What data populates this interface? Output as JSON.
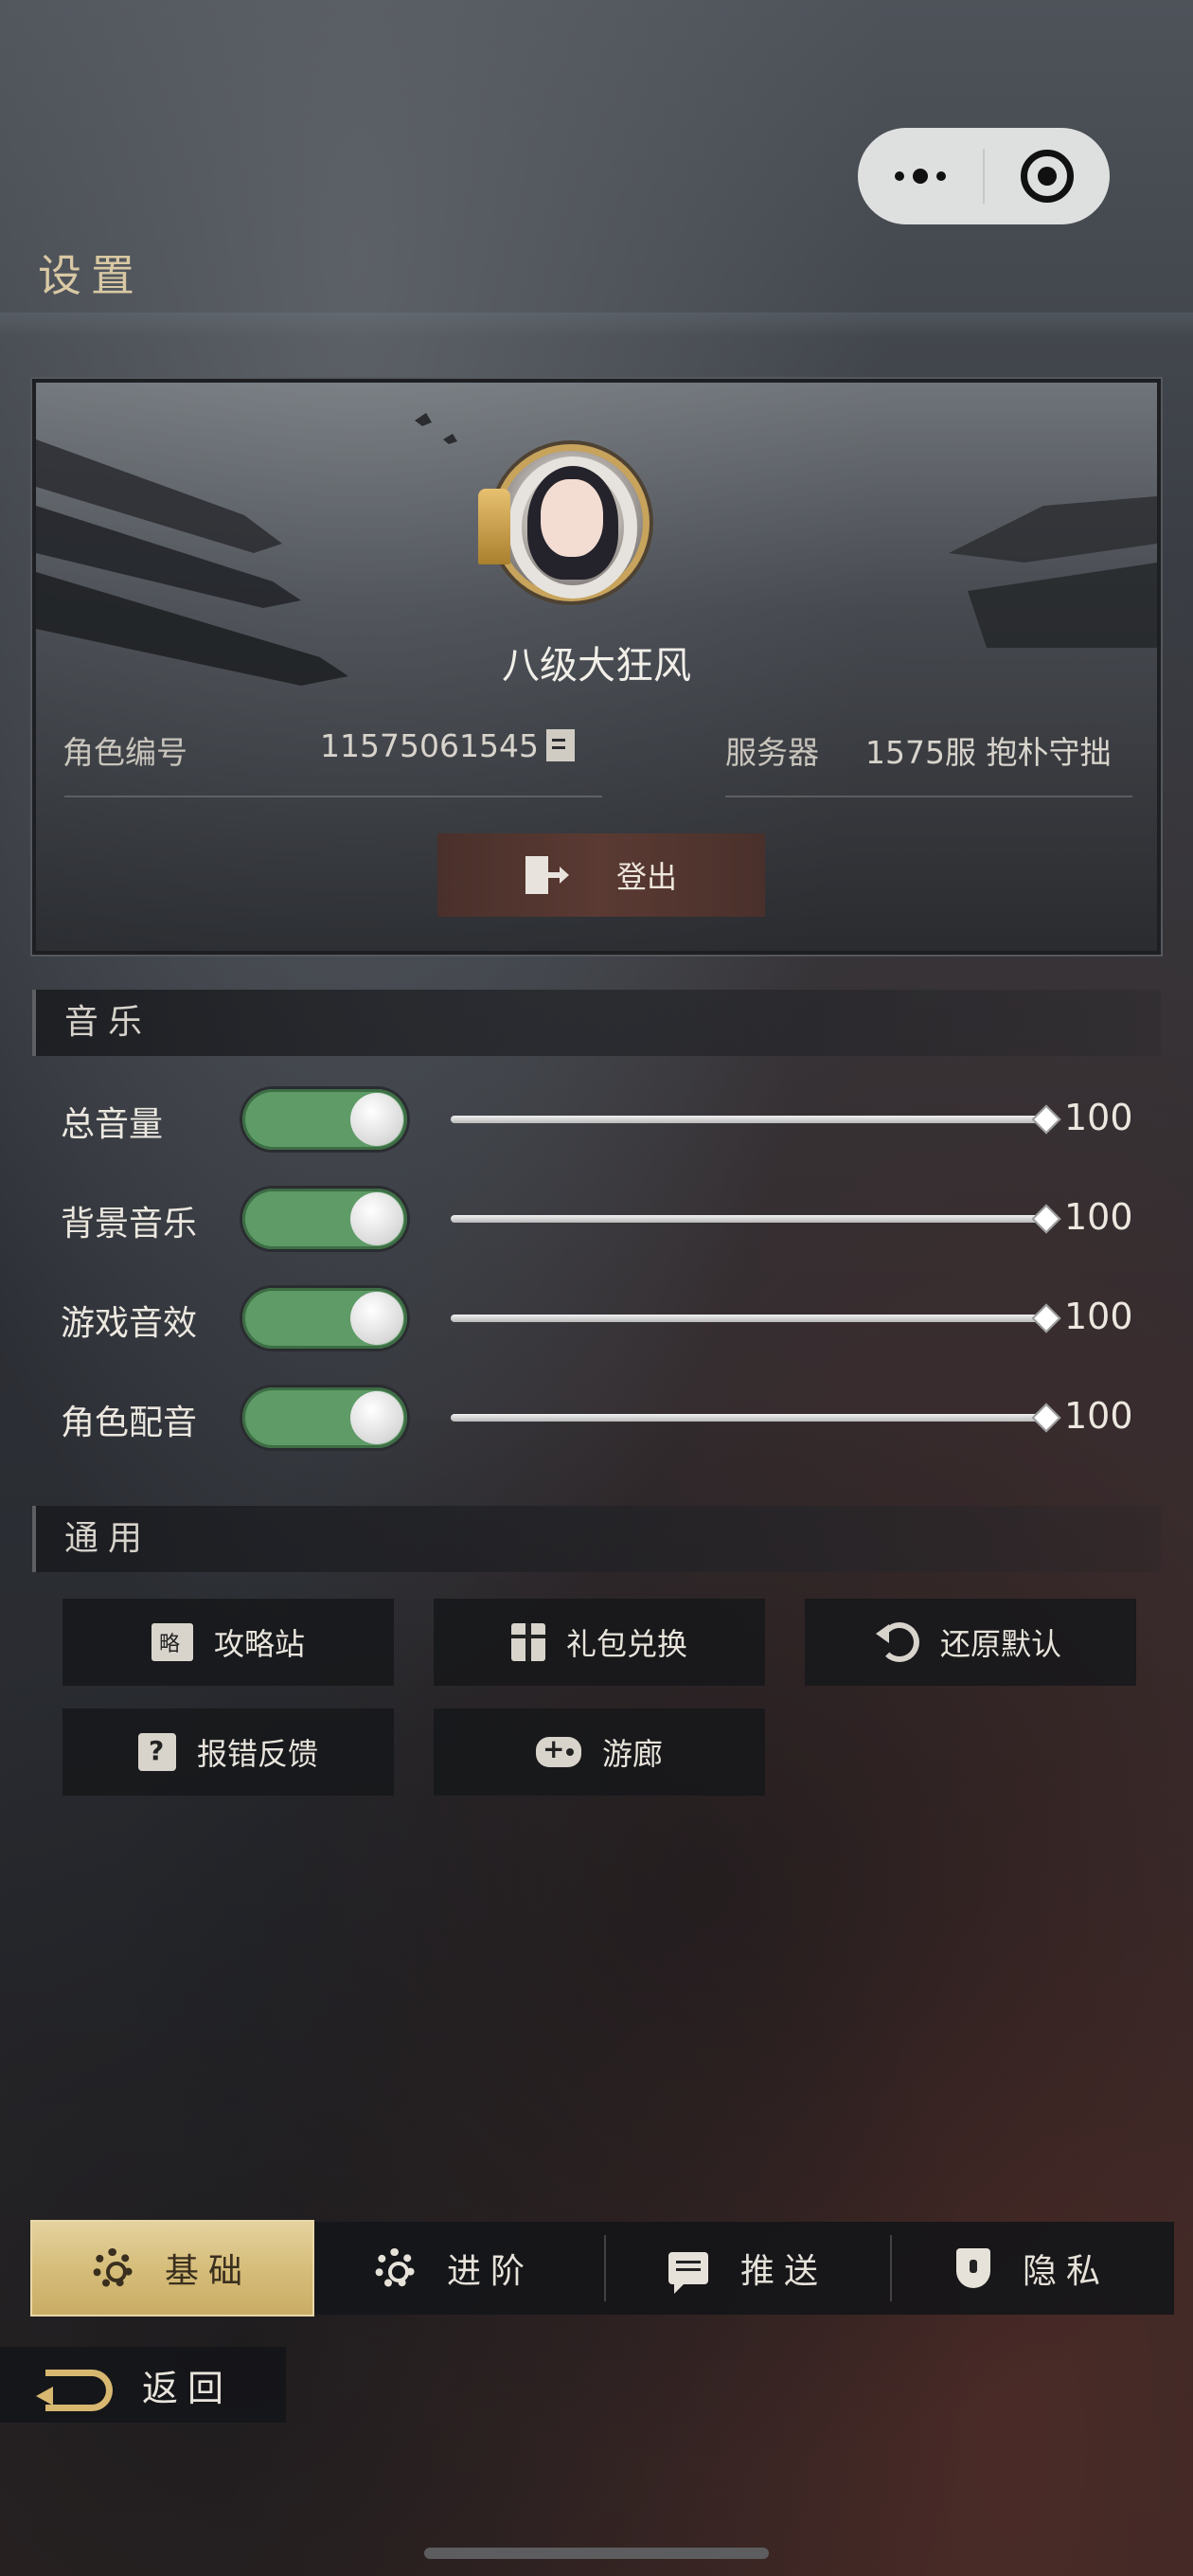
{
  "capsule": {
    "more_icon": "more-dots-icon",
    "close_icon": "target-circle-icon"
  },
  "page": {
    "title": "设置"
  },
  "profile": {
    "name": "八级大狂风",
    "role_id_label": "角色编号",
    "role_id": "11575061545",
    "server_label": "服务器",
    "server_value": "1575服 抱朴守拙",
    "logout_label": "登出"
  },
  "music": {
    "header": "音乐",
    "rows": [
      {
        "label": "总音量",
        "enabled": true,
        "value": "100"
      },
      {
        "label": "背景音乐",
        "enabled": true,
        "value": "100"
      },
      {
        "label": "游戏音效",
        "enabled": true,
        "value": "100"
      },
      {
        "label": "角色配音",
        "enabled": true,
        "value": "100"
      }
    ]
  },
  "general": {
    "header": "通用",
    "buttons": [
      {
        "label": "攻略站",
        "icon": "guide-icon"
      },
      {
        "label": "礼包兑换",
        "icon": "gift-icon"
      },
      {
        "label": "还原默认",
        "icon": "reset-icon"
      },
      {
        "label": "报错反馈",
        "icon": "feedback-icon"
      },
      {
        "label": "游廊",
        "icon": "gamepad-icon"
      }
    ]
  },
  "tabs": [
    {
      "label": "基础",
      "active": true
    },
    {
      "label": "进阶",
      "active": false
    },
    {
      "label": "推送",
      "active": false
    },
    {
      "label": "隐私",
      "active": false
    }
  ],
  "back": {
    "label": "返回"
  },
  "colors": {
    "toggle_on": "#5e9b67",
    "tab_active": "#d6bd7a",
    "accent_gold": "#c7a35c"
  }
}
